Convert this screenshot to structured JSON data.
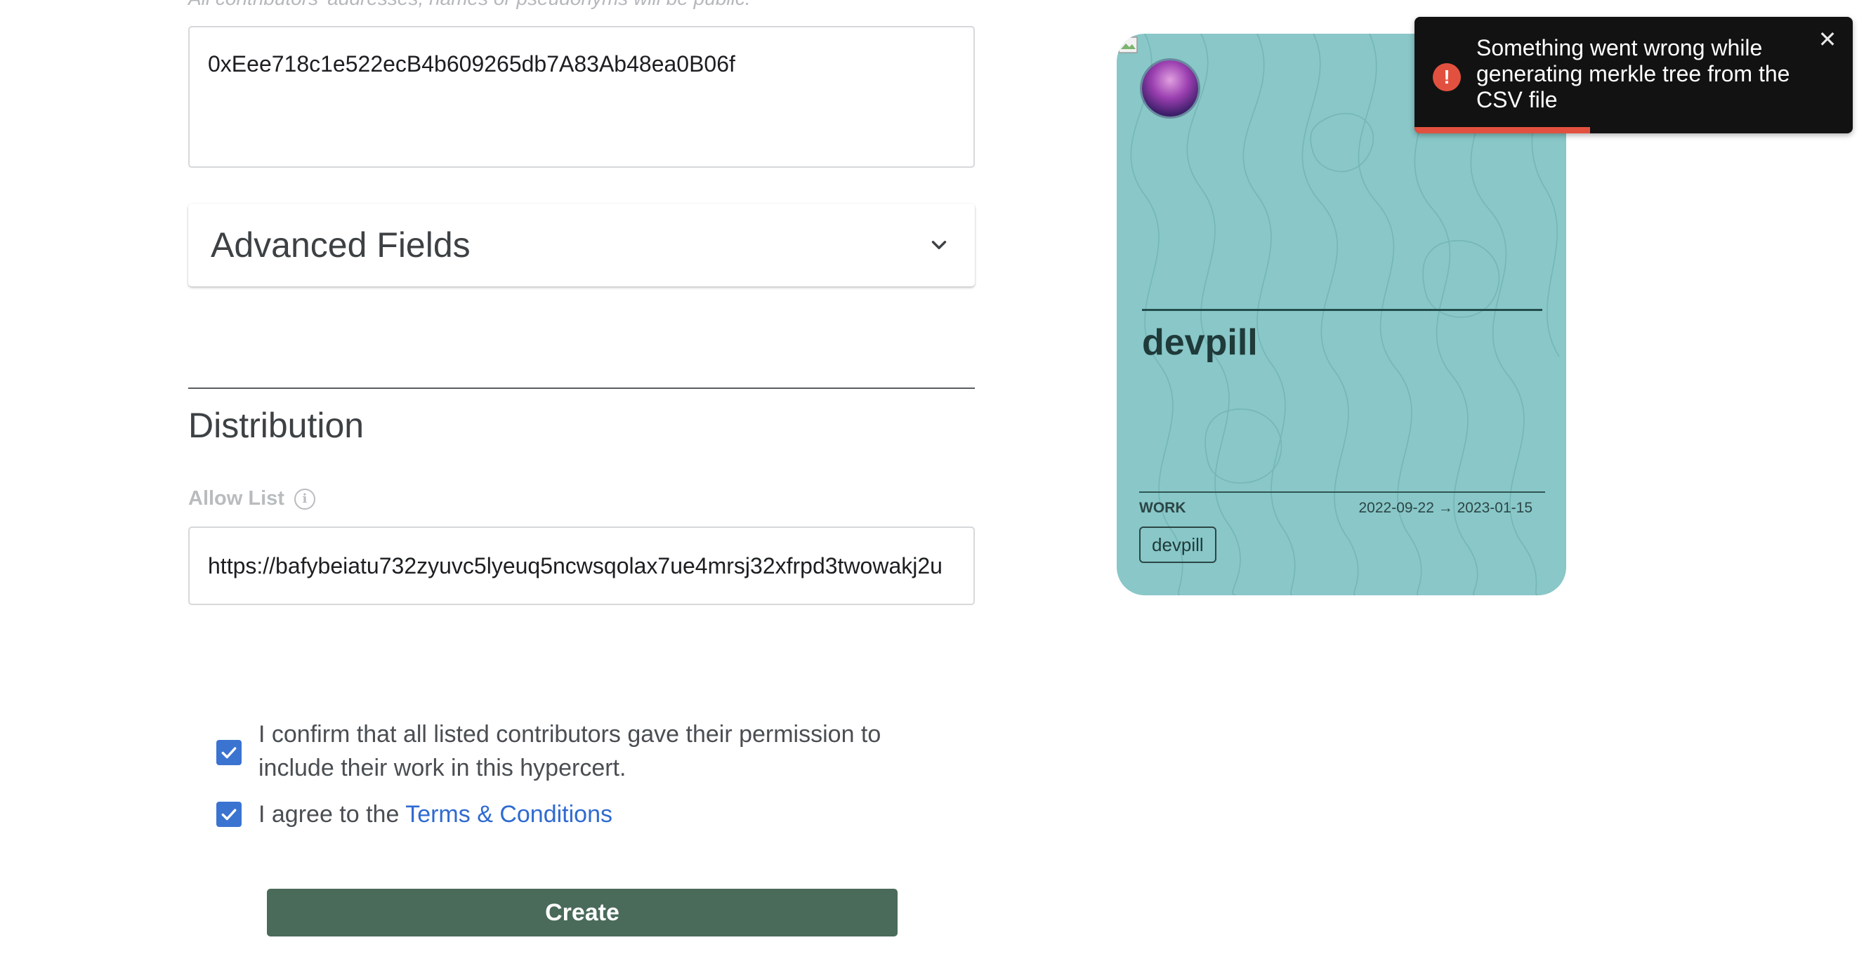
{
  "form": {
    "contributors_helper": "All contributors' addresses, names or pseudonyms will be public.",
    "contributors_value": "0xEee718c1e522ecB4b609265db7A83Ab48ea0B06f",
    "advanced_fields_label": "Advanced Fields",
    "distribution_title": "Distribution",
    "allow_list_label": "Allow List",
    "allow_list_value": "https://bafybeiatu732zyuvc5lyeuq5ncwsqolax7ue4mrsj32xfrpd3twowakj2u",
    "confirm_permission_text": "I confirm that all listed contributors gave their permission to include their work in this hypercert.",
    "terms_prefix": "I agree to the ",
    "terms_link": "Terms & Conditions",
    "create_label": "Create",
    "confirm_checked": true,
    "terms_checked": true
  },
  "card": {
    "title": "devpill",
    "work_label": "WORK",
    "dates": "2022-09-22 → 2023-01-15",
    "tag": "devpill",
    "background_color": "#89c7c8"
  },
  "toast": {
    "message": "Something went wrong while generating merkle tree from the CSV file",
    "close_glyph": "✕",
    "icon_glyph": "!",
    "progress_fraction": 0.4,
    "accent_color": "#e2513f"
  },
  "colors": {
    "primary_button": "#4a6a5a",
    "checkbox": "#3b73d1",
    "link": "#2f6ad0"
  }
}
